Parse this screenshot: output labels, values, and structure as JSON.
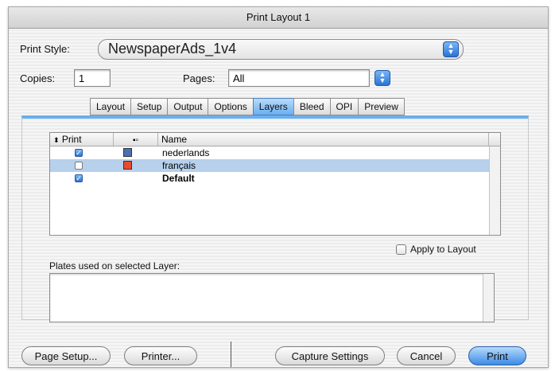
{
  "window": {
    "title": "Print Layout 1"
  },
  "print_style": {
    "label": "Print Style:",
    "value": "NewspaperAds_1v4"
  },
  "copies": {
    "label": "Copies:",
    "value": "1"
  },
  "pages": {
    "label": "Pages:",
    "value": "All"
  },
  "tabs": [
    {
      "label": "Layout",
      "active": false
    },
    {
      "label": "Setup",
      "active": false
    },
    {
      "label": "Output",
      "active": false
    },
    {
      "label": "Options",
      "active": false
    },
    {
      "label": "Layers",
      "active": true
    },
    {
      "label": "Bleed",
      "active": false
    },
    {
      "label": "OPI",
      "active": false
    },
    {
      "label": "Preview",
      "active": false
    }
  ],
  "layers_table": {
    "headers": {
      "print": "Print",
      "name": "Name"
    },
    "rows": [
      {
        "name": "nederlands",
        "print": true,
        "color": "#4a6fb5",
        "selected": false,
        "bold": false
      },
      {
        "name": "français",
        "print": false,
        "color": "#e84a2e",
        "selected": true,
        "bold": false
      },
      {
        "name": "Default",
        "print": true,
        "color": null,
        "selected": false,
        "bold": true
      }
    ]
  },
  "apply_to_layout": {
    "label": "Apply to Layout",
    "checked": false
  },
  "plates": {
    "label": "Plates used on selected Layer:"
  },
  "buttons": {
    "page_setup": "Page Setup...",
    "printer": "Printer...",
    "capture_settings": "Capture Settings",
    "cancel": "Cancel",
    "print": "Print"
  },
  "colors": {
    "accent": "#3d8be6",
    "selection": "#b7d0ec"
  }
}
